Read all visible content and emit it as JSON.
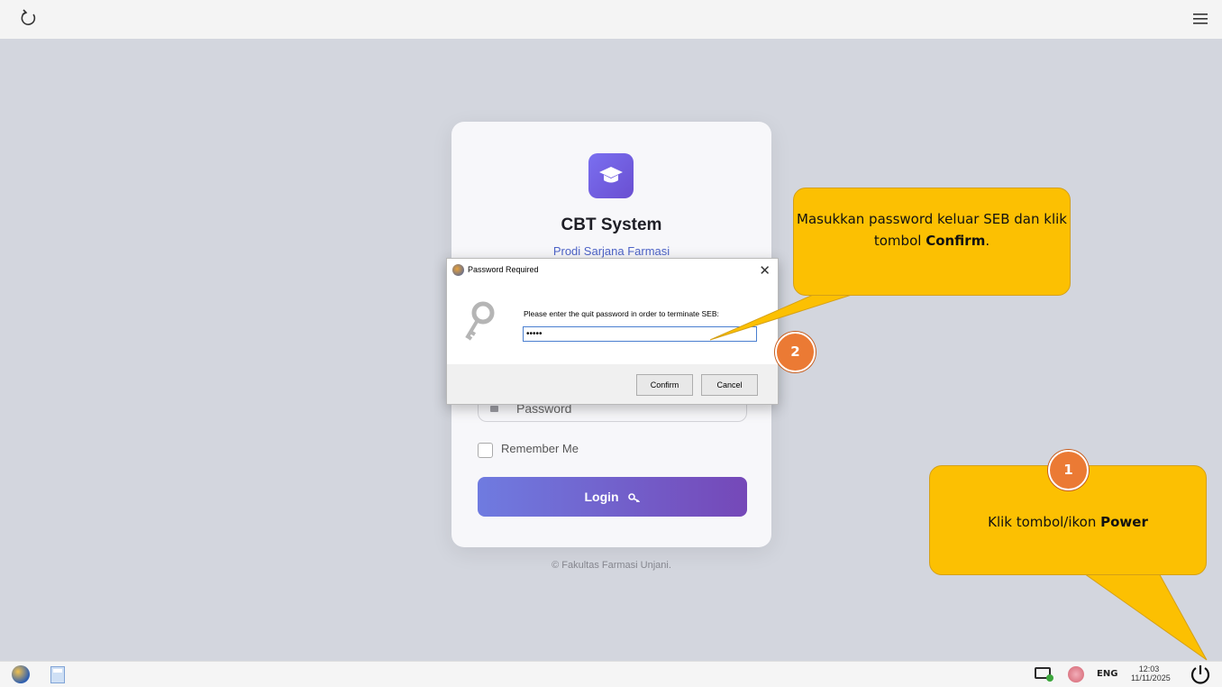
{
  "topbar": {
    "reload_icon": "reload-icon",
    "menu_icon": "hamburger-menu-icon"
  },
  "login_card": {
    "logo_icon": "graduation-cap-icon",
    "title": "CBT System",
    "subtitle": "Prodi Sarjana Farmasi",
    "password_placeholder": "Password",
    "remember_label": "Remember Me",
    "login_button": "Login",
    "copyright": "© Fakultas Farmasi Unjani."
  },
  "dialog": {
    "title": "Password Required",
    "prompt": "Please enter the quit password in order to terminate SEB:",
    "password_value": "•••••",
    "confirm_label": "Confirm",
    "cancel_label": "Cancel",
    "close_glyph": "✕"
  },
  "callouts": {
    "step2_text_part1": "Masukkan password keluar SEB dan klik tombol ",
    "step2_bold": "Confirm",
    "step2_text_part2": ".",
    "step2_number": "2",
    "step1_text_part1": "Klik tombol/ikon ",
    "step1_bold": "Power",
    "step1_number": "1"
  },
  "taskbar": {
    "language": "ENG",
    "time": "12:03",
    "date": "11/11/2025"
  },
  "colors": {
    "callout": "#fcc002",
    "badge": "#eb7a34",
    "login_gradient_start": "#6f7be0",
    "login_gradient_end": "#7548b8",
    "subtitle": "#4e64c8"
  }
}
